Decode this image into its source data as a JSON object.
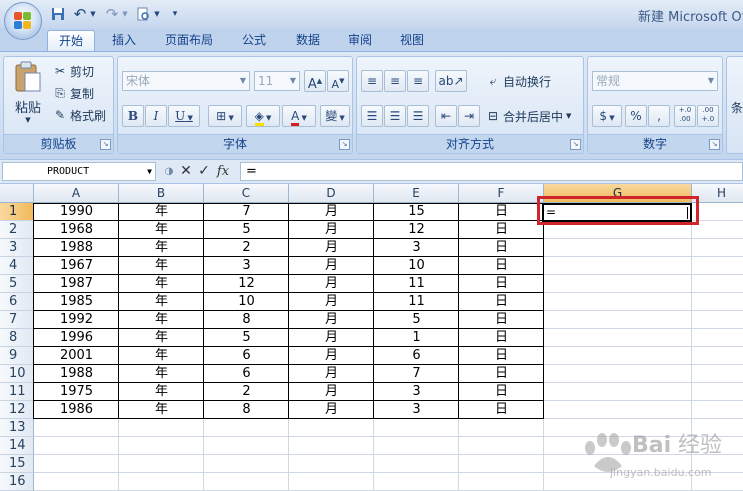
{
  "window": {
    "title": "新建 Microsoft Of"
  },
  "quick_access": {
    "items": [
      "save-icon",
      "undo-icon",
      "redo-icon",
      "print-preview-icon",
      "customize-icon"
    ]
  },
  "tabs": [
    {
      "label": "开始",
      "active": true
    },
    {
      "label": "插入"
    },
    {
      "label": "页面布局"
    },
    {
      "label": "公式"
    },
    {
      "label": "数据"
    },
    {
      "label": "审阅"
    },
    {
      "label": "视图"
    }
  ],
  "ribbon": {
    "clipboard": {
      "label": "剪贴板",
      "paste": "粘贴",
      "cut": "剪切",
      "copy": "复制",
      "format_painter": "格式刷"
    },
    "font": {
      "label": "字体",
      "font_name": "宋体",
      "font_size": "11",
      "grow": "A",
      "shrink": "A",
      "bold": "B",
      "italic": "I",
      "underline": "U",
      "phonetic": "變"
    },
    "alignment": {
      "label": "对齐方式",
      "wrap_text": "自动换行",
      "merge_center": "合并后居中"
    },
    "number": {
      "label": "数字",
      "format": "常规",
      "percent": "%",
      "comma": ",",
      "inc_decimal": "+.0 .00",
      "dec_decimal": ".00 +.0"
    },
    "styles": {
      "label_partial": "条"
    }
  },
  "formula_bar": {
    "name_box": "PRODUCT",
    "fx": "fx",
    "formula": "="
  },
  "columns": [
    "A",
    "B",
    "C",
    "D",
    "E",
    "F",
    "G",
    "H"
  ],
  "rows": [
    "1",
    "2",
    "3",
    "4",
    "5",
    "6",
    "7",
    "8",
    "9",
    "10",
    "11",
    "12",
    "13",
    "14",
    "15",
    "16"
  ],
  "table": [
    [
      "1990",
      "年",
      "7",
      "月",
      "15",
      "日"
    ],
    [
      "1968",
      "年",
      "5",
      "月",
      "12",
      "日"
    ],
    [
      "1988",
      "年",
      "2",
      "月",
      "3",
      "日"
    ],
    [
      "1967",
      "年",
      "3",
      "月",
      "10",
      "日"
    ],
    [
      "1987",
      "年",
      "12",
      "月",
      "11",
      "日"
    ],
    [
      "1985",
      "年",
      "10",
      "月",
      "11",
      "日"
    ],
    [
      "1992",
      "年",
      "8",
      "月",
      "5",
      "日"
    ],
    [
      "1996",
      "年",
      "5",
      "月",
      "1",
      "日"
    ],
    [
      "2001",
      "年",
      "6",
      "月",
      "6",
      "日"
    ],
    [
      "1988",
      "年",
      "6",
      "月",
      "7",
      "日"
    ],
    [
      "1975",
      "年",
      "2",
      "月",
      "3",
      "日"
    ],
    [
      "1986",
      "年",
      "8",
      "月",
      "3",
      "日"
    ]
  ],
  "active_cell": {
    "ref": "G1",
    "value": "="
  },
  "colors": {
    "selection_header": "#f1b95b",
    "highlight": "#d0252b",
    "ribbon": "#d0def0"
  },
  "watermark": {
    "brand": "Baidu经验",
    "url": "jingyan.baidu.com"
  }
}
